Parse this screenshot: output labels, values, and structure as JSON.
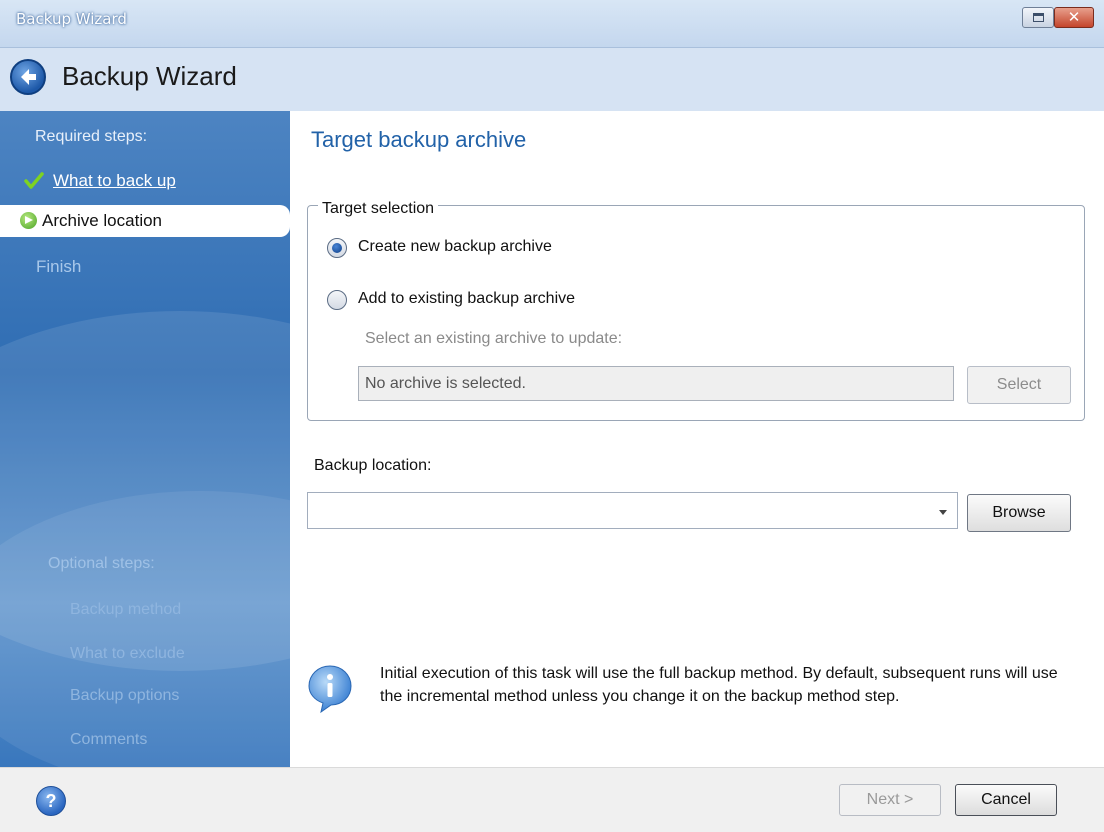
{
  "window": {
    "title": "Backup Wizard",
    "restore_icon": "restore-icon",
    "close_glyph": "✕"
  },
  "header": {
    "title": "Backup Wizard",
    "back_icon": "back-arrow-icon"
  },
  "sidebar": {
    "required_heading": "Required steps:",
    "steps": [
      {
        "label": "What to back up",
        "state": "done"
      },
      {
        "label": "Archive location",
        "state": "active"
      },
      {
        "label": "Finish",
        "state": "disabled"
      }
    ],
    "optional_heading": "Optional steps:",
    "optional_steps": [
      "Backup method",
      "What to exclude",
      "Backup options",
      "Comments"
    ]
  },
  "main": {
    "title": "Target backup archive",
    "target_selection": {
      "legend": "Target selection",
      "options": [
        {
          "label": "Create new backup archive",
          "checked": true
        },
        {
          "label": "Add to existing backup archive",
          "checked": false
        }
      ],
      "existing_label": "Select an existing archive to update:",
      "archive_value": "No archive is selected.",
      "select_button": "Select"
    },
    "backup_location": {
      "label": "Backup location:",
      "value": "",
      "browse_button": "Browse"
    },
    "info": {
      "icon": "info-icon",
      "text": "Initial execution of this task will use the full backup method. By default, subsequent runs will use the incremental method unless you change it on the backup method step."
    }
  },
  "footer": {
    "help_glyph": "?",
    "next_button": "Next >",
    "cancel_button": "Cancel"
  },
  "colors": {
    "accent": "#2262a8",
    "sidebar": "#3a76b9"
  }
}
